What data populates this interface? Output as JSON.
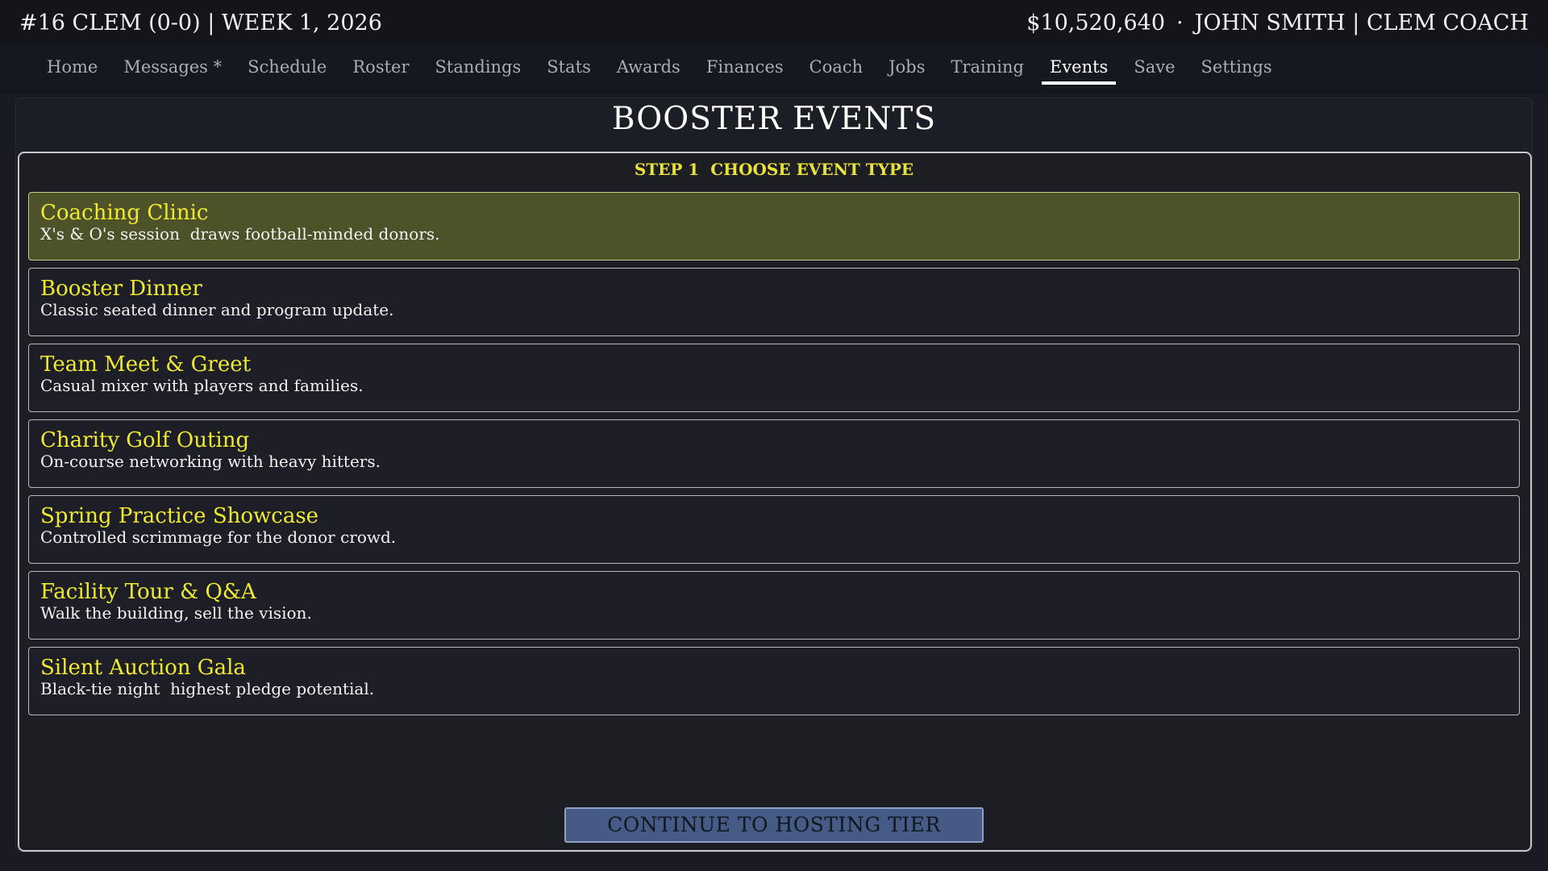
{
  "topbar": {
    "team_info": "#16 CLEM (0-0) | WEEK 1, 2026",
    "money": "$10,520,640",
    "separator": "·",
    "coach": "JOHN SMITH | CLEM COACH"
  },
  "nav": {
    "items": [
      {
        "label": "Home"
      },
      {
        "label": "Messages *"
      },
      {
        "label": "Schedule"
      },
      {
        "label": "Roster"
      },
      {
        "label": "Standings"
      },
      {
        "label": "Stats"
      },
      {
        "label": "Awards"
      },
      {
        "label": "Finances"
      },
      {
        "label": "Coach"
      },
      {
        "label": "Jobs"
      },
      {
        "label": "Training"
      },
      {
        "label": "Events"
      },
      {
        "label": "Save"
      },
      {
        "label": "Settings"
      }
    ],
    "active": "Events"
  },
  "page": {
    "title": "BOOSTER EVENTS",
    "step_label": "STEP 1  CHOOSE EVENT TYPE"
  },
  "events": [
    {
      "title": "Coaching Clinic",
      "desc": "X's & O's session  draws football-minded donors.",
      "selected": true
    },
    {
      "title": "Booster Dinner",
      "desc": "Classic seated dinner and program update.",
      "selected": false
    },
    {
      "title": "Team Meet & Greet",
      "desc": "Casual mixer with players and families.",
      "selected": false
    },
    {
      "title": "Charity Golf Outing",
      "desc": "On-course networking with heavy hitters.",
      "selected": false
    },
    {
      "title": "Spring Practice Showcase",
      "desc": "Controlled scrimmage for the donor crowd.",
      "selected": false
    },
    {
      "title": "Facility Tour & Q&A",
      "desc": "Walk the building, sell the vision.",
      "selected": false
    },
    {
      "title": "Silent Auction Gala",
      "desc": "Black-tie night  highest pledge potential.",
      "selected": false
    }
  ],
  "actions": {
    "continue_label": "CONTINUE TO HOSTING TIER"
  },
  "colors": {
    "accent_yellow": "#f0ea2e",
    "selected_bg": "#4d5228",
    "button_bg": "#455a84"
  }
}
